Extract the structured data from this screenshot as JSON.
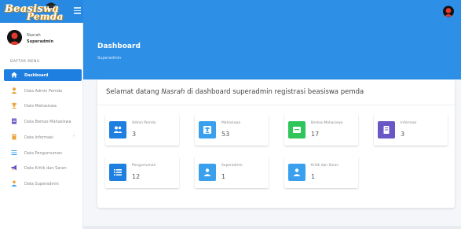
{
  "app": {
    "logo_line1": "Beasiswa",
    "logo_line2": "Pemda"
  },
  "colors": {
    "primary": "#2d8fe6",
    "active": "#1f7fe0",
    "blue": "#1f7fe0",
    "light_blue": "#3aa0ee",
    "green": "#2fc55a",
    "purple": "#6a56c4"
  },
  "sidebar": {
    "user_name": "Nasrah",
    "user_role": "Superadmin",
    "menu_header": "DAFTAR MENU",
    "items": [
      {
        "label": "Dashboard",
        "icon": "home-icon"
      },
      {
        "label": "Data Admin Pemda",
        "icon": "user-icon"
      },
      {
        "label": "Data Mahasiswa",
        "icon": "graduate-icon"
      },
      {
        "label": "Data Berkas Mahasiswa",
        "icon": "file-icon"
      },
      {
        "label": "Data Informasi",
        "icon": "book-icon"
      },
      {
        "label": "Data Pengumuman",
        "icon": "list-icon"
      },
      {
        "label": "Data Kritik dan Saran",
        "icon": "megaphone-icon"
      },
      {
        "label": "Data Superadmin",
        "icon": "admin-icon"
      }
    ]
  },
  "hero": {
    "title": "Dashboard",
    "subtitle": "Superadmin"
  },
  "welcome": {
    "before": "Selamat datang ",
    "name": "Nasrah",
    "after": " di dashboard superadmin registrasi beasiswa pemda"
  },
  "stats": [
    {
      "label": "Admin Pemda",
      "value": "3",
      "icon": "users-icon",
      "color": "#1f7fe0"
    },
    {
      "label": "Mahasiswa",
      "value": "53",
      "icon": "graduate-icon",
      "color": "#3aa0ee"
    },
    {
      "label": "Berkas Mahasiswa",
      "value": "17",
      "icon": "folder-icon",
      "color": "#2fc55a"
    },
    {
      "label": "Informasi",
      "value": "3",
      "icon": "book-icon",
      "color": "#6a56c4"
    },
    {
      "label": "Pengumuman",
      "value": "12",
      "icon": "list-icon",
      "color": "#1f7fe0"
    },
    {
      "label": "Superadmin",
      "value": "1",
      "icon": "admin-icon",
      "color": "#3aa0ee"
    },
    {
      "label": "Kritik dan Saran",
      "value": "1",
      "icon": "admin-icon",
      "color": "#3aa0ee"
    }
  ]
}
